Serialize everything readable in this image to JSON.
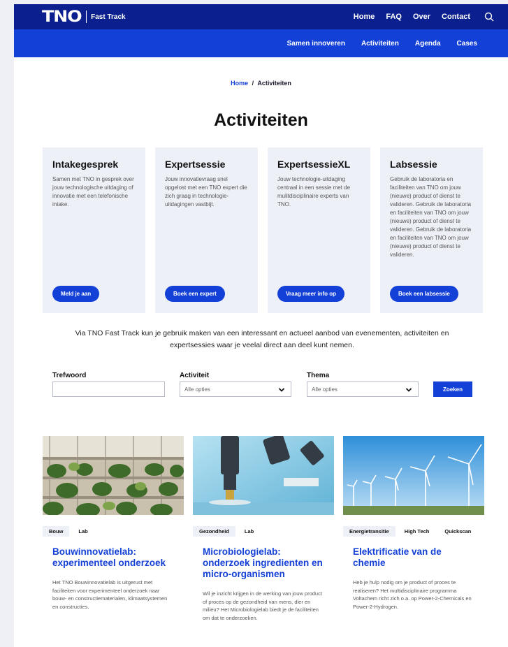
{
  "header": {
    "logo": "TNO",
    "logo_sub": "Fast Track",
    "nav": [
      "Home",
      "FAQ",
      "Over",
      "Contact"
    ]
  },
  "subnav": [
    "Samen innoveren",
    "Activiteiten",
    "Agenda",
    "Cases"
  ],
  "breadcrumb": {
    "home": "Home",
    "separator": "/",
    "current": "Activiteiten"
  },
  "page_title": "Activiteiten",
  "cards": [
    {
      "title": "Intakegesprek",
      "text": "Samen met TNO  in gesprek over jouw technologische uitdaging of innovatie met een telefonische intake.",
      "button": "Meld je aan"
    },
    {
      "title": "Expertsessie",
      "text": "Jouw innovatievraag snel opgelost met een TNO expert die zich graag in technologie-uitdagingen vastbijt.",
      "button": "Boek een expert"
    },
    {
      "title": "ExpertsessieXL",
      "text": "Jouw technologie-uitdaging centraal in een sessie met de mulitdisciplinaire experts van TNO.",
      "button": "Vraag meer info op"
    },
    {
      "title": "Labsessie",
      "text": "Gebruik de laboratoria en faciliteiten van TNO om jouw (nieuwe) product of dienst te valideren. Gebruik de laboratoria en faciliteiten van TNO om jouw (nieuwe) product of dienst te valideren. Gebruik de laboratoria en faciliteiten van TNO om jouw (nieuwe) product of dienst te valideren.",
      "button": "Boek een labsessie"
    }
  ],
  "intro": "Via TNO Fast Track kun je gebruik maken van een interessant en actueel aanbod van evenementen, activiteiten en expertsessies waar je veelal direct aan deel kunt nemen.",
  "filters": {
    "keyword_label": "Trefwoord",
    "keyword_value": "",
    "activity_label": "Activiteit",
    "activity_value": "Alle opties",
    "theme_label": "Thema",
    "theme_value": "Alle opties",
    "search_button": "Zoeken"
  },
  "articles": [
    {
      "tags": [
        "Bouw",
        "Lab"
      ],
      "title": "Bouwinnovatielab: experimenteel onderzoek",
      "text": "Het TNO Bouwinnovatielab is uitgerust met faciliteiten voor experimenteel onderzoek naar bouw- en constructiematerialen, klimaatsystemen en constructies."
    },
    {
      "tags": [
        "Gezondheid",
        "Lab"
      ],
      "title": "Microbiologielab: onderzoek ingredienten en micro-organismen",
      "text": "Wil je inzicht krijgen in de werking van jouw product of proces op de gezondheid van mens, dier en milieu? Het Microbiologielab biedt je de faciliteiten om dat te onderzoeken."
    },
    {
      "tags": [
        "Energietransitie",
        "High Tech",
        "Quickscan"
      ],
      "title": "Elektrificatie van de chemie",
      "text": "Heb je hulp nodig om je product of proces te realiseren? Het multidisciplinaire programma Voltachem richt zich o.a. op Power-2-Chemicals en Power-2-Hydrogen."
    }
  ],
  "colors": {
    "dark_blue": "#0b1f8f",
    "brand_blue": "#1340d6",
    "card_bg": "#eef0f8"
  }
}
